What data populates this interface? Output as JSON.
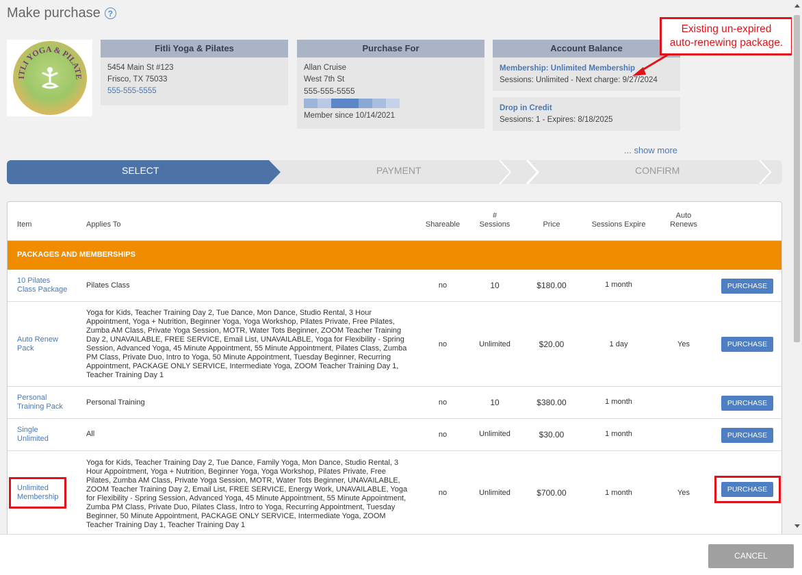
{
  "header": {
    "title": "Make purchase"
  },
  "logo": {
    "text": "FITLI YOGA & PILATES"
  },
  "studio": {
    "name": "Fitli Yoga & Pilates",
    "address1": "5454 Main St #123",
    "address2": "Frisco, TX 75033",
    "phone": "555-555-5555"
  },
  "purchase_for": {
    "heading": "Purchase For",
    "name": "Allan Cruise",
    "street": "West 7th St",
    "phone": "555-555-5555",
    "member_since": "Member since 10/14/2021"
  },
  "account_balance": {
    "heading": "Account Balance",
    "items": [
      {
        "title": "Membership: Unlimited Membership",
        "detail": "Sessions: Unlimited -  Next charge: 9/27/2024"
      },
      {
        "title": "Drop in Credit",
        "detail": "Sessions: 1 -  Expires: 8/18/2025"
      }
    ],
    "show_more": "... show more"
  },
  "annotation": {
    "line1": "Existing un-expired",
    "line2": "auto-renewing package."
  },
  "steps": [
    "SELECT",
    "PAYMENT",
    "CONFIRM"
  ],
  "table": {
    "headers": {
      "item": "Item",
      "applies": "Applies To",
      "shareable": "Shareable",
      "sessions_top": "#",
      "sessions_bottom": "Sessions",
      "price": "Price",
      "expire": "Sessions Expire",
      "auto_top": "Auto",
      "auto_bottom": "Renews"
    },
    "section": "PACKAGES AND MEMBERSHIPS",
    "button_label": "PURCHASE",
    "rows": [
      {
        "item1": "10 Pilates",
        "item2": "Class Package",
        "applies": "Pilates Class",
        "shareable": "no",
        "sessions": "10",
        "price": "$180.00",
        "expire": "1 month",
        "auto": ""
      },
      {
        "item1": "Auto Renew",
        "item2": "Pack",
        "applies": "Yoga for Kids, Teacher Training Day 2, Tue Dance, Mon Dance, Studio Rental, 3 Hour Appointment, Yoga + Nutrition, Beginner Yoga, Yoga Workshop, Pilates Private, Free Pilates, Zumba AM Class, Private Yoga Session, MOTR, Water Tots Beginner, ZOOM Teacher Training Day 2, UNAVAILABLE, FREE SERVICE, Email List, UNAVAILABLE, Yoga for Flexibility - Spring Session, Advanced Yoga, 45 Minute Appointment, 55 Minute Appointment, Pilates Class, Zumba PM Class, Private Duo, Intro to Yoga, 50 Minute Appointment, Tuesday Beginner, Recurring Appointment, PACKAGE ONLY SERVICE, Intermediate Yoga, ZOOM Teacher Training Day 1, Teacher Training Day 1",
        "shareable": "no",
        "sessions": "Unlimited",
        "price": "$20.00",
        "expire": "1 day",
        "auto": "Yes"
      },
      {
        "item1": "Personal",
        "item2": "Training Pack",
        "applies": "Personal Training",
        "shareable": "no",
        "sessions": "10",
        "price": "$380.00",
        "expire": "1 month",
        "auto": ""
      },
      {
        "item1": "Single",
        "item2": "Unlimited",
        "applies": "All",
        "shareable": "no",
        "sessions": "Unlimited",
        "price": "$30.00",
        "expire": "1 month",
        "auto": ""
      },
      {
        "item1": "Unlimited",
        "item2": "Membership",
        "applies": "Yoga for Kids, Teacher Training Day 2, Tue Dance, Family Yoga, Mon Dance, Studio Rental, 3 Hour Appointment, Yoga + Nutrition, Beginner Yoga, Yoga Workshop, Pilates Private, Free Pilates, Zumba AM Class, Private Yoga Session, MOTR, Water Tots Beginner, UNAVAILABLE, ZOOM Teacher Training Day 2, Email List, FREE SERVICE, Energy Work, UNAVAILABLE, Yoga for Flexibility - Spring Session, Advanced Yoga, 45 Minute Appointment, 55 Minute Appointment, Zumba PM Class, Private Duo, Pilates Class, Intro to Yoga, Recurring Appointment, Tuesday Beginner, 50 Minute Appointment, PACKAGE ONLY SERVICE, Intermediate Yoga, ZOOM Teacher Training Day 1, Teacher Training Day 1",
        "shareable": "no",
        "sessions": "Unlimited",
        "price": "$700.00",
        "expire": "1 month",
        "auto": "Yes"
      }
    ]
  },
  "footer": {
    "cancel": "CANCEL"
  },
  "colors": {
    "accent": "#4d73a6",
    "section": "#f08c00",
    "highlight": "#e1131a",
    "button": "#4d7fc2"
  }
}
